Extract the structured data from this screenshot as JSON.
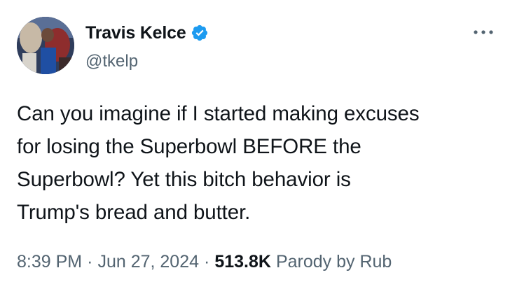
{
  "tweet": {
    "author": {
      "name": "Travis Kelce",
      "handle": "@tkelp",
      "verified": true,
      "verified_color": "#1d9bf0"
    },
    "text": "Can you imagine if I started making excuses\nfor losing the Superbowl BEFORE the\nSuperbowl? Yet this bitch behavior is\nTrump's bread and butter.",
    "time": "8:39 PM",
    "date": "Jun 27, 2024",
    "separator": "·",
    "views_count": "513.8K",
    "source_label": "Parody by Rub",
    "more_icon": "more-horizontal-icon"
  }
}
